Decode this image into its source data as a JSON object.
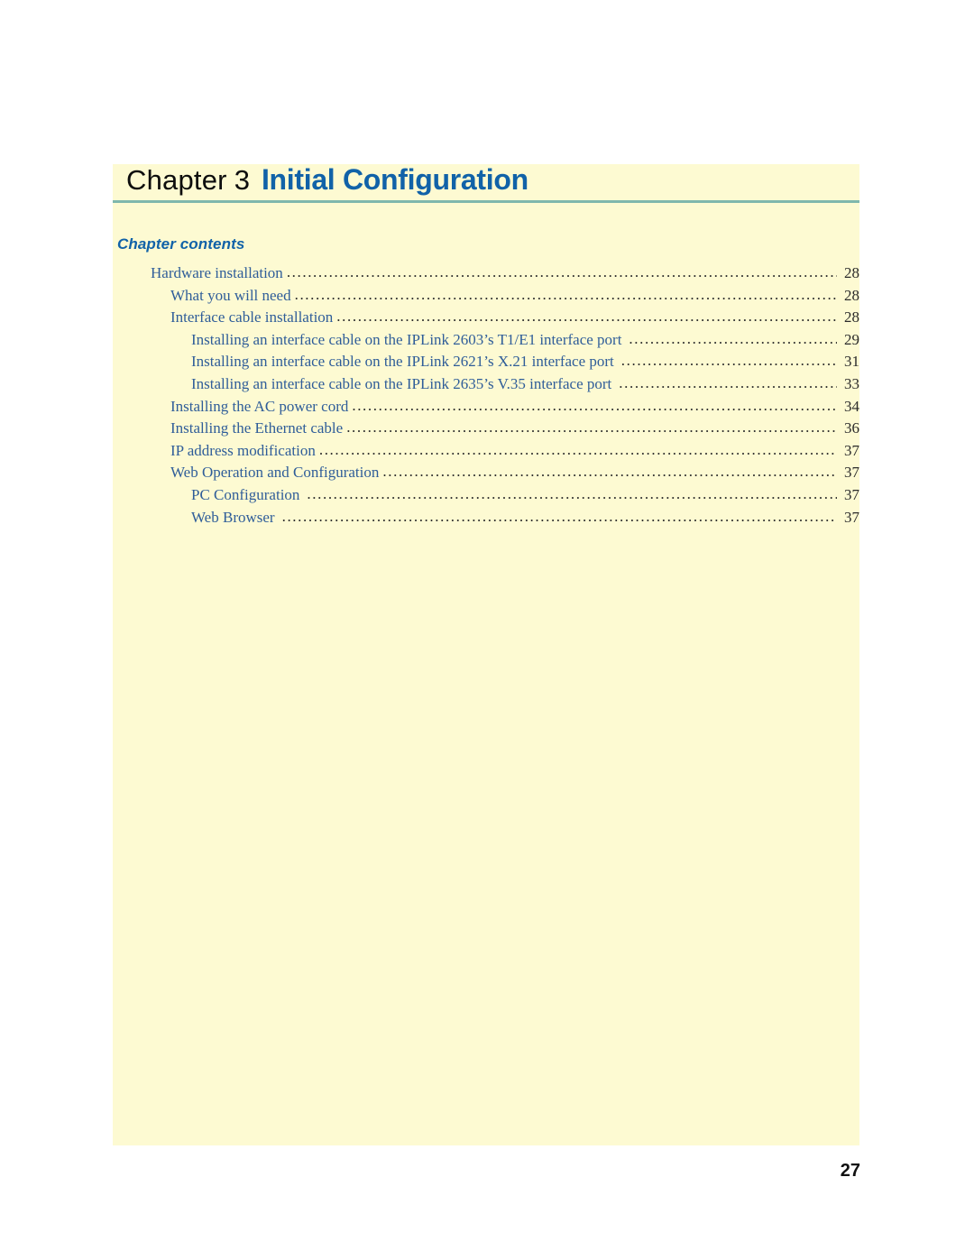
{
  "page": {
    "background_color": "#ffffff",
    "panel_color": "#fdfad2",
    "rule_color": "#7fb7ad",
    "accent_blue": "#1162a8",
    "toc_text_color": "#2f5d99",
    "folio": "27"
  },
  "heading": {
    "chapter_word": "Chapter",
    "chapter_number": "3",
    "title": "Initial Configuration"
  },
  "contents": {
    "label": "Chapter contents",
    "leader_dots": "....................................................................................................................................................................................................",
    "items": [
      {
        "label": "Hardware installation",
        "page": "28",
        "level": 1
      },
      {
        "label": "What you will need",
        "page": "28",
        "level": 2
      },
      {
        "label": "Interface cable installation",
        "page": "28",
        "level": 2
      },
      {
        "label": "Installing an interface cable on the IPLink 2603’s T1/E1 interface port",
        "page": "29",
        "level": 3
      },
      {
        "label": "Installing an interface cable on the IPLink 2621’s X.21 interface port",
        "page": "31",
        "level": 3
      },
      {
        "label": "Installing an interface cable on the IPLink 2635’s V.35 interface port",
        "page": "33",
        "level": 3
      },
      {
        "label": "Installing the AC power cord",
        "page": "34",
        "level": 2
      },
      {
        "label": "Installing the Ethernet cable",
        "page": "36",
        "level": 2
      },
      {
        "label": "IP address modification",
        "page": "37",
        "level": 2
      },
      {
        "label": "Web Operation and Configuration",
        "page": "37",
        "level": 2
      },
      {
        "label": "PC Configuration",
        "page": "37",
        "level": 3
      },
      {
        "label": "Web Browser",
        "page": "37",
        "level": 3
      }
    ]
  }
}
